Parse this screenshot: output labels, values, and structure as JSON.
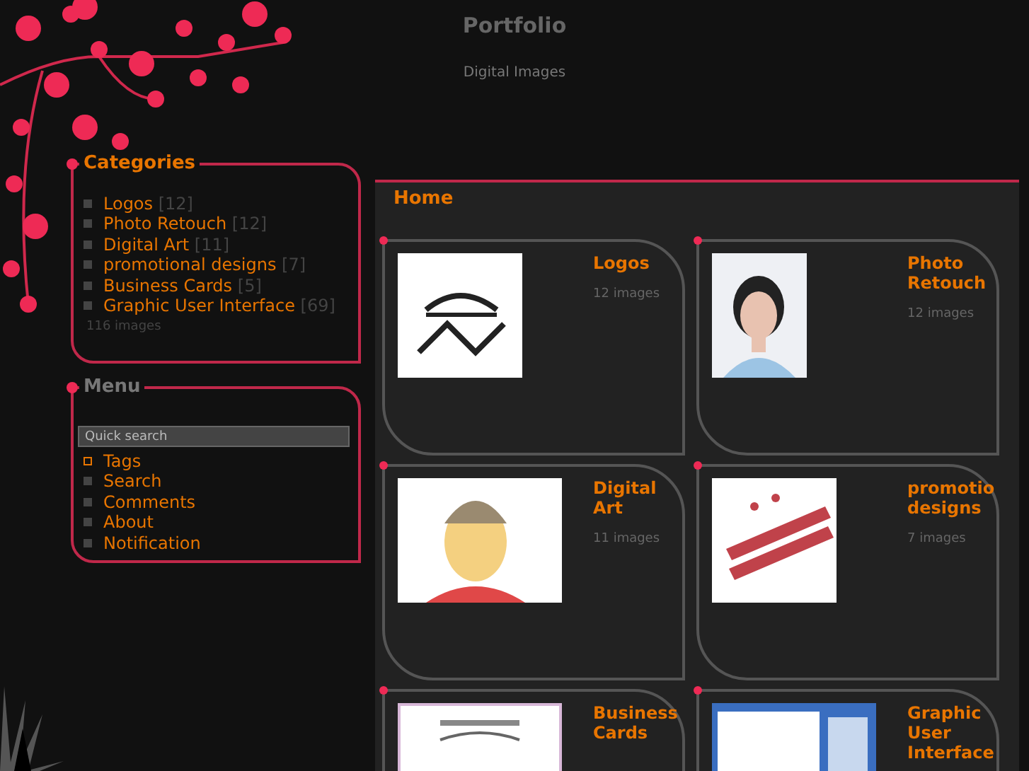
{
  "header": {
    "title": "Portfolio",
    "subtitle": "Digital Images"
  },
  "categories": {
    "title": "Categories",
    "items": [
      {
        "name": "Logos",
        "count": "[12]"
      },
      {
        "name": "Photo Retouch",
        "count": "[12]"
      },
      {
        "name": "Digital Art",
        "count": "[11]"
      },
      {
        "name": "promotional designs",
        "count": "[7]"
      },
      {
        "name": "Business Cards",
        "count": "[5]"
      },
      {
        "name": "Graphic User Interface",
        "count": "[69]"
      }
    ],
    "total": "116 images"
  },
  "menu": {
    "title": "Menu",
    "search": {
      "placeholder": "Quick search"
    },
    "items": [
      {
        "label": "Tags",
        "selected": true
      },
      {
        "label": "Search",
        "selected": false
      },
      {
        "label": "Comments",
        "selected": false
      },
      {
        "label": "About",
        "selected": false
      },
      {
        "label": "Notification",
        "selected": false
      }
    ]
  },
  "main": {
    "heading": "Home",
    "albums": [
      {
        "title": "Logos",
        "count": "12 images"
      },
      {
        "title": "Photo Retouch",
        "count": "12 images"
      },
      {
        "title": "Digital Art",
        "count": "11 images"
      },
      {
        "title": "promotio designs",
        "count": "7 images"
      },
      {
        "title": "Business Cards"
      },
      {
        "title": "Graphic User Interface"
      }
    ]
  }
}
